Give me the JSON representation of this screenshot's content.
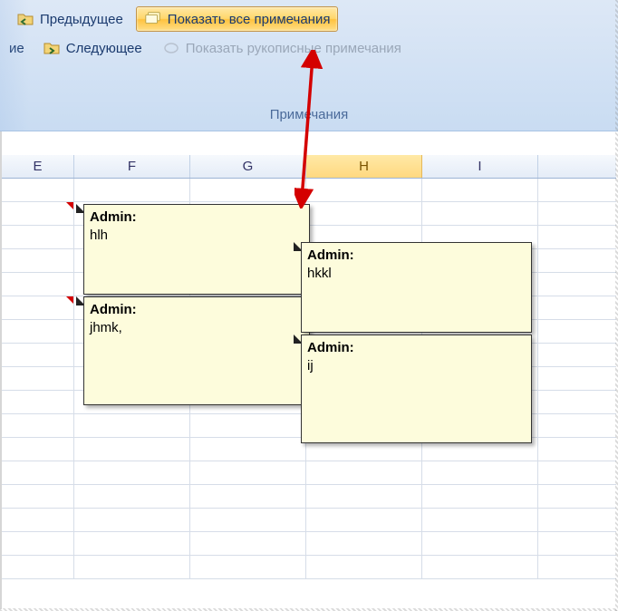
{
  "ribbon": {
    "tab_fragment": "ие",
    "prev": "Предыдущее",
    "next": "Следующее",
    "show_all": "Показать все примечания",
    "show_ink": "Показать рукописные примечания",
    "group": "Примечания"
  },
  "columns": [
    {
      "label": "E",
      "w": 128
    },
    {
      "label": "F",
      "w": 128
    },
    {
      "label": "G",
      "w": 128
    },
    {
      "label": "H",
      "w": 128,
      "selected": true
    },
    {
      "label": "I",
      "w": 50
    }
  ],
  "comments": [
    {
      "author": "Admin:",
      "text": "hlh"
    },
    {
      "author": "Admin:",
      "text": "jhmk,"
    },
    {
      "author": "Admin:",
      "text": "hkkl"
    },
    {
      "author": "Admin:",
      "text": "ij"
    }
  ]
}
